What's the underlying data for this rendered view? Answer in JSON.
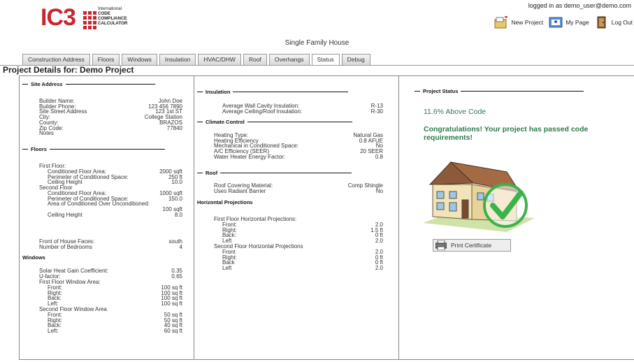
{
  "header": {
    "logo": {
      "mark": "IC3",
      "lines": [
        "International",
        "CODE",
        "COMPLIANCE",
        "CALCULATOR"
      ]
    },
    "logged_in": "logged in as demo_user@demo.com",
    "links": [
      {
        "label": "New Project",
        "icon": "new-project-icon"
      },
      {
        "label": "My Page",
        "icon": "my-page-icon"
      },
      {
        "label": "Log Out",
        "icon": "log-out-icon"
      }
    ]
  },
  "page_title": "Single Family House",
  "tabs": [
    {
      "label": "Construction Address",
      "active": false
    },
    {
      "label": "Floors",
      "active": false
    },
    {
      "label": "Windows",
      "active": false
    },
    {
      "label": "Insulation",
      "active": false
    },
    {
      "label": "HVAC/DHW",
      "active": false
    },
    {
      "label": "Roof",
      "active": false
    },
    {
      "label": "Overhangs",
      "active": false
    },
    {
      "label": "Status",
      "active": true
    },
    {
      "label": "Debug",
      "active": false
    }
  ],
  "project_title": "Project Details for: Demo Project",
  "site_address": {
    "heading": "Site Address",
    "rows": [
      {
        "label": "Builder Name:",
        "value": "John Doe"
      },
      {
        "label": "Builder Phone:",
        "value": "123 456 7890"
      },
      {
        "label": "Site Street Address",
        "value": "123 1st ST"
      },
      {
        "label": "City:",
        "value": "College Station"
      },
      {
        "label": "County:",
        "value": "BRAZOS"
      },
      {
        "label": "Zip Code:",
        "value": "77840"
      },
      {
        "label": "Notes",
        "value": ""
      }
    ]
  },
  "floors": {
    "heading": "Floors",
    "first_floor_label": "First Floor:",
    "first_floor": [
      {
        "label": "Conditioned Floor Area:",
        "value": "2000 sqft"
      },
      {
        "label": "Perimeter of Conditioned Space:",
        "value": "250 ft"
      },
      {
        "label": "Ceiling Height",
        "value": "10.0"
      }
    ],
    "second_floor_label": "Second Floor",
    "second_floor": [
      {
        "label": "Conditioned Floor Area:",
        "value": "1000 sqft"
      },
      {
        "label": "Perimeter of Conditioned Space:",
        "value": "150.0"
      },
      {
        "label": "Area of Conditioned Over Unconditioned:",
        "value": ""
      },
      {
        "label": "",
        "value": "100 sqft"
      },
      {
        "label": "Ceiling Height",
        "value": "8.0"
      }
    ],
    "extra": [
      {
        "label": "Front of House Faces:",
        "value": "south"
      },
      {
        "label": "Number of Bedrooms",
        "value": "4"
      }
    ]
  },
  "windows": {
    "heading": "Windows",
    "rows": [
      {
        "label": "Solar Heat Gain Coefficient:",
        "value": "0.35"
      },
      {
        "label": "U-factor:",
        "value": "0.65"
      }
    ],
    "first_floor_label": "First Floor Window Area:",
    "first_floor": [
      {
        "label": "Front:",
        "value": "100 sq ft"
      },
      {
        "label": "Right:",
        "value": "100 sq ft"
      },
      {
        "label": "Back:",
        "value": "100 sq ft"
      },
      {
        "label": "Left:",
        "value": "100 sq ft"
      }
    ],
    "second_floor_label": "Second Floor Window Area",
    "second_floor": [
      {
        "label": "Front:",
        "value": "50 sq ft"
      },
      {
        "label": "Right:",
        "value": "50 sq ft"
      },
      {
        "label": "Back:",
        "value": "40 sq ft"
      },
      {
        "label": "Left:",
        "value": "60 sq ft"
      }
    ]
  },
  "insulation": {
    "heading": "Insulation",
    "rows": [
      {
        "label": "Average Wall Cavity Insulation:",
        "value": "R-13"
      },
      {
        "label": "Average Ceiling/Roof Insulation:",
        "value": "R-30"
      }
    ]
  },
  "climate": {
    "heading": "Climate Control",
    "rows": [
      {
        "label": "Heating Type:",
        "value": "Natural Gas"
      },
      {
        "label": "Heating Efficiency",
        "value": "0.8 AFUE"
      },
      {
        "label": "Mechanical in Conditioned Space:",
        "value": "No"
      },
      {
        "label": "A/C Efficiency (SEER)",
        "value": "20 SEER"
      },
      {
        "label": "Water Heater Energy Factor:",
        "value": "0.8"
      }
    ]
  },
  "roof": {
    "heading": "Roof",
    "rows": [
      {
        "label": "Roof Covering Material:",
        "value": "Comp Shingle"
      },
      {
        "label": "Uses Radiant Barrier",
        "value": "No"
      }
    ]
  },
  "projections": {
    "heading": "Horizontal Projections",
    "first_floor_label": "First Floor Horizontal Projections:",
    "first_floor": [
      {
        "label": "Front:",
        "value": "2.0"
      },
      {
        "label": "Right:",
        "value": "1.5 ft"
      },
      {
        "label": "Back:",
        "value": "0 ft"
      },
      {
        "label": "Left",
        "value": "2.0"
      }
    ],
    "second_floor_label": "Second Floor Horizontal Projections",
    "second_floor": [
      {
        "label": "Front",
        "value": "2.0"
      },
      {
        "label": "Right:",
        "value": "0 ft"
      },
      {
        "label": "Back",
        "value": "0 ft"
      },
      {
        "label": "Left",
        "value": "2.0"
      }
    ]
  },
  "status": {
    "heading": "Project Status",
    "above_code": "11.6% Above Code",
    "message": "Congratulations! Your project has passed code requirements!",
    "print_label": "Print Certificate"
  },
  "colors": {
    "brand_red": "#c8272d",
    "status_green": "#2d7a4a",
    "check_green": "#3bb34a"
  }
}
